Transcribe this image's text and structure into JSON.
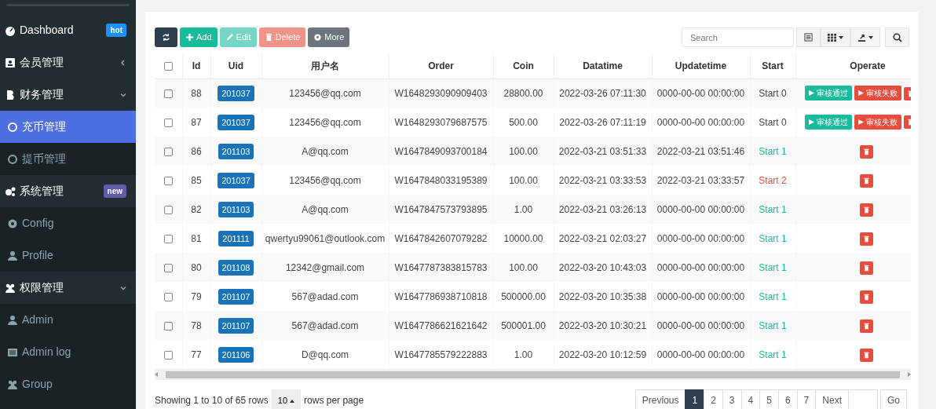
{
  "sidebar": {
    "items": [
      {
        "label": "Dashboard",
        "badge": {
          "text": "hot",
          "color": "#1e90ff"
        },
        "selected": false
      },
      {
        "label": "会员管理",
        "expanded": false,
        "selected": false
      },
      {
        "label": "财务管理",
        "expanded": true,
        "selected": false,
        "children": [
          {
            "label": "充币管理",
            "selected": true
          },
          {
            "label": "提币管理",
            "selected": false
          }
        ]
      },
      {
        "label": "系统管理",
        "badge": {
          "text": "new",
          "color": "#605ca8"
        },
        "selected": false,
        "children": [
          {
            "label": "Config",
            "selected": false
          },
          {
            "label": "Profile",
            "selected": false
          }
        ]
      },
      {
        "label": "权限管理",
        "expanded": true,
        "selected": false,
        "children": [
          {
            "label": "Admin",
            "selected": false
          },
          {
            "label": "Admin log",
            "selected": false
          },
          {
            "label": "Group",
            "selected": false
          }
        ]
      }
    ]
  },
  "toolbar": {
    "buttons": [
      {
        "kind": "refresh"
      },
      {
        "kind": "add",
        "label": "Add",
        "disabled": false
      },
      {
        "kind": "edit",
        "label": "Edit",
        "disabled": true
      },
      {
        "kind": "delete",
        "label": "Delete",
        "disabled": true
      },
      {
        "kind": "more",
        "label": "More",
        "disabled": false
      }
    ],
    "search": {
      "placeholder": "Search"
    }
  },
  "table": {
    "select_all_checked": false,
    "columns": [
      "Id",
      "Uid",
      "用户名",
      "Order",
      "Coin",
      "Datatime",
      "Updatetime",
      "Start",
      "Operate"
    ],
    "rows": [
      {
        "id": "88",
        "uid": "201037",
        "user": "123456@qq.com",
        "order": "W1648293090909403",
        "coin": "28800.00",
        "datatime": "2022-03-26 07:11:30",
        "updatetime": "0000-00-00 00:00:00",
        "start": {
          "text": "Start 0",
          "color": "#444444"
        },
        "actions": [
          "审核通过",
          "审核失败"
        ],
        "checked": false
      },
      {
        "id": "87",
        "uid": "201037",
        "user": "123456@qq.com",
        "order": "W1648293079687575",
        "coin": "500.00",
        "datatime": "2022-03-26 07:11:19",
        "updatetime": "0000-00-00 00:00:00",
        "start": {
          "text": "Start 0",
          "color": "#444444"
        },
        "actions": [
          "审核通过",
          "审核失败"
        ],
        "checked": false
      },
      {
        "id": "86",
        "uid": "201103",
        "user": "A@qq.com",
        "order": "W1647849093700184",
        "coin": "100.00",
        "datatime": "2022-03-21 03:51:33",
        "updatetime": "2022-03-21 03:51:46",
        "start": {
          "text": "Start 1",
          "color": "#18bc9c"
        },
        "checked": false
      },
      {
        "id": "85",
        "uid": "201037",
        "user": "123456@qq.com",
        "order": "W1647848033195389",
        "coin": "100.00",
        "datatime": "2022-03-21 03:33:53",
        "updatetime": "2022-03-21 03:33:57",
        "start": {
          "text": "Start 2",
          "color": "#e74c3c"
        },
        "checked": false
      },
      {
        "id": "82",
        "uid": "201103",
        "user": "A@qq.com",
        "order": "W1647847573793895",
        "coin": "1.00",
        "datatime": "2022-03-21 03:26:13",
        "updatetime": "0000-00-00 00:00:00",
        "start": {
          "text": "Start 1",
          "color": "#18bc9c"
        },
        "checked": false
      },
      {
        "id": "81",
        "uid": "201111",
        "user": "qwertyu99061@outlook.com",
        "order": "W1647842607079282",
        "coin": "10000.00",
        "datatime": "2022-03-21 02:03:27",
        "updatetime": "0000-00-00 00:00:00",
        "start": {
          "text": "Start 1",
          "color": "#18bc9c"
        },
        "checked": false
      },
      {
        "id": "80",
        "uid": "201108",
        "user": "12342@gmail.com",
        "order": "W1647787383815783",
        "coin": "100.00",
        "datatime": "2022-03-20 10:43:03",
        "updatetime": "0000-00-00 00:00:00",
        "start": {
          "text": "Start 1",
          "color": "#18bc9c"
        },
        "checked": false
      },
      {
        "id": "79",
        "uid": "201107",
        "user": "567@adad.com",
        "order": "W1647786938710818",
        "coin": "500000.00",
        "datatime": "2022-03-20 10:35:38",
        "updatetime": "0000-00-00 00:00:00",
        "start": {
          "text": "Start 1",
          "color": "#18bc9c"
        },
        "checked": false
      },
      {
        "id": "78",
        "uid": "201107",
        "user": "567@adad.com",
        "order": "W1647786621621642",
        "coin": "500001.00",
        "datatime": "2022-03-20 10:30:21",
        "updatetime": "0000-00-00 00:00:00",
        "start": {
          "text": "Start 1",
          "color": "#18bc9c"
        },
        "checked": false
      },
      {
        "id": "77",
        "uid": "201106",
        "user": "D@qq.com",
        "order": "W1647785579222883",
        "coin": "1.00",
        "datatime": "2022-03-20 10:12:59",
        "updatetime": "0000-00-00 00:00:00",
        "start": {
          "text": "Start 1",
          "color": "#18bc9c"
        },
        "checked": false
      }
    ]
  },
  "footer": {
    "summary": "Showing 1 to 10 of 65 rows",
    "page_size": "10",
    "page_size_label": "rows per page",
    "pages": [
      {
        "label": "Previous",
        "selected": false
      },
      {
        "label": "1",
        "selected": true
      },
      {
        "label": "2",
        "selected": false
      },
      {
        "label": "3",
        "selected": false
      },
      {
        "label": "4",
        "selected": false
      },
      {
        "label": "5",
        "selected": false
      },
      {
        "label": "6",
        "selected": false
      },
      {
        "label": "7",
        "selected": false
      },
      {
        "label": "Next",
        "selected": false
      }
    ],
    "go": "Go"
  }
}
